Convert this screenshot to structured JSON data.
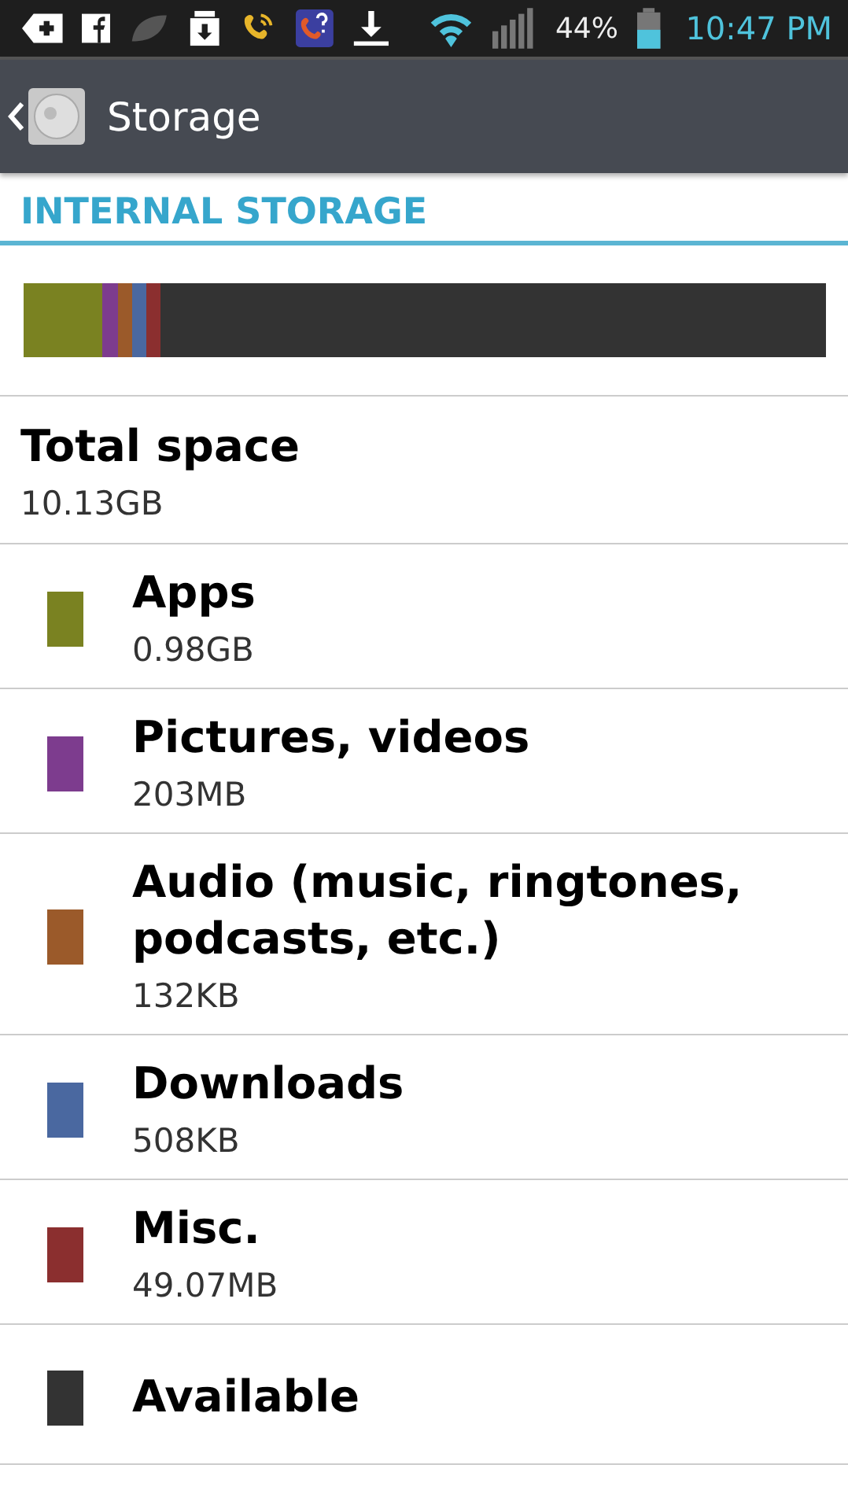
{
  "status_bar": {
    "battery": "44%",
    "time": "10:47 PM"
  },
  "app_bar": {
    "title": "Storage"
  },
  "section": {
    "title": "INTERNAL STORAGE"
  },
  "usage_bar": {
    "segments": [
      {
        "color": "#7a8221"
      },
      {
        "color": "#7d3c8e"
      },
      {
        "color": "#9b5a2a"
      },
      {
        "color": "#4a68a0"
      },
      {
        "color": "#8b2f2f"
      }
    ]
  },
  "total": {
    "label": "Total space",
    "value": "10.13GB"
  },
  "items": [
    {
      "label": "Apps",
      "value": "0.98GB",
      "color": "#7a8221"
    },
    {
      "label": "Pictures, videos",
      "value": "203MB",
      "color": "#7d3c8e"
    },
    {
      "label": "Audio (music, ringtones, podcasts, etc.)",
      "value": "132KB",
      "color": "#9b5a2a"
    },
    {
      "label": "Downloads",
      "value": "508KB",
      "color": "#4a68a0"
    },
    {
      "label": "Misc.",
      "value": "49.07MB",
      "color": "#8b2f2f"
    },
    {
      "label": "Available",
      "color": "#333333"
    }
  ]
}
